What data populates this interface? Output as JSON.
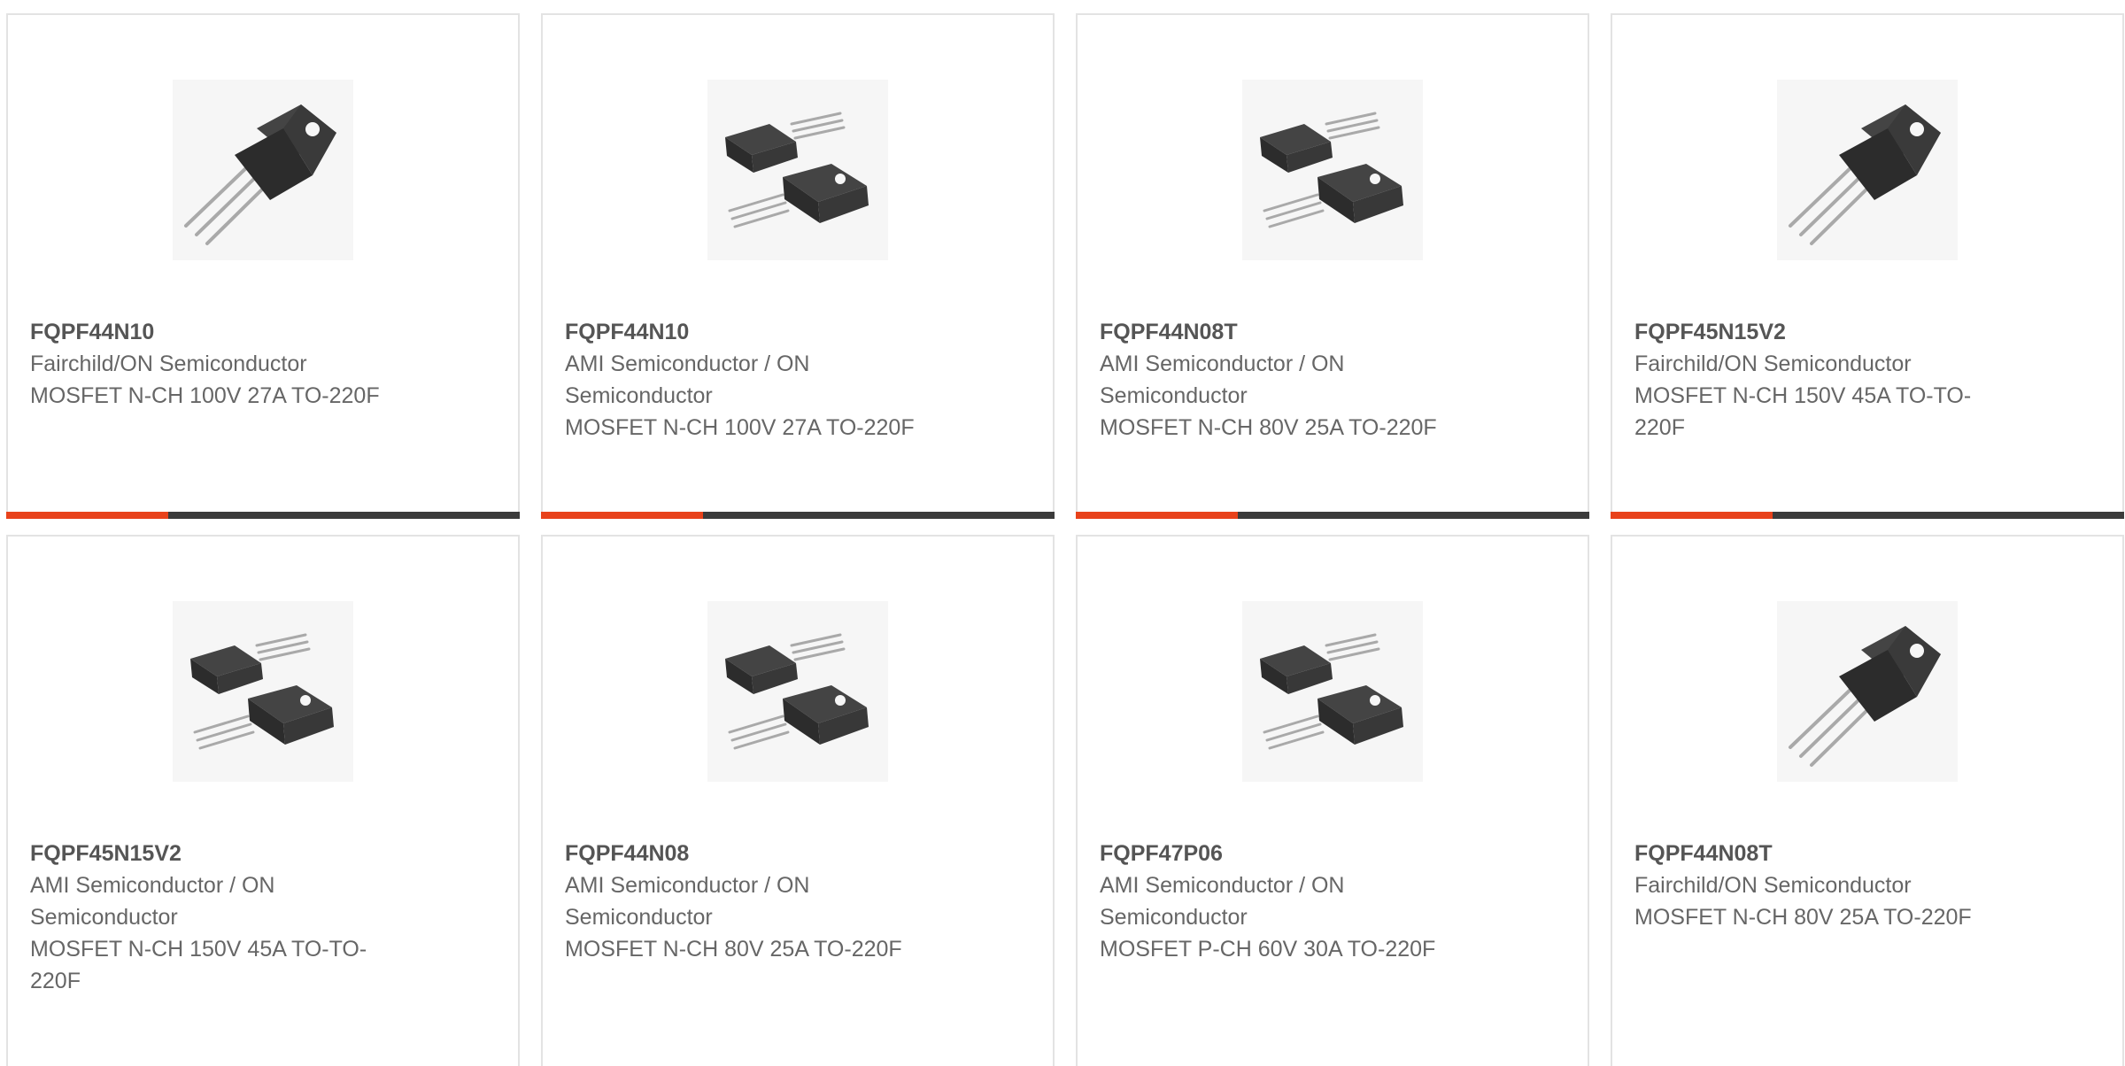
{
  "products": [
    {
      "part": "FQPF44N10",
      "manufacturer": "Fairchild/ON Semiconductor",
      "description": "MOSFET N-CH 100V 27A TO-220F",
      "image_icon": "to220f-single-icon"
    },
    {
      "part": "FQPF44N10",
      "manufacturer": "AMI Semiconductor / ON Semiconductor",
      "description": "MOSFET N-CH 100V 27A TO-220F",
      "image_icon": "to220f-pair-icon"
    },
    {
      "part": "FQPF44N08T",
      "manufacturer": "AMI Semiconductor / ON Semiconductor",
      "description": "MOSFET N-CH 80V 25A TO-220F",
      "image_icon": "to220f-pair-icon"
    },
    {
      "part": "FQPF45N15V2",
      "manufacturer": "Fairchild/ON Semiconductor",
      "description": "MOSFET N-CH 150V 45A TO-TO-220F",
      "image_icon": "to220f-single-icon"
    },
    {
      "part": "FQPF45N15V2",
      "manufacturer": "AMI Semiconductor / ON Semiconductor",
      "description": "MOSFET N-CH 150V 45A TO-TO-220F",
      "image_icon": "to220f-pair-icon"
    },
    {
      "part": "FQPF44N08",
      "manufacturer": "AMI Semiconductor / ON Semiconductor",
      "description": "MOSFET N-CH 80V 25A TO-220F",
      "image_icon": "to220f-pair-icon"
    },
    {
      "part": "FQPF47P06",
      "manufacturer": "AMI Semiconductor / ON Semiconductor",
      "description": "MOSFET P-CH 60V 30A TO-220F",
      "image_icon": "to220f-pair-icon"
    },
    {
      "part": "FQPF44N08T",
      "manufacturer": "Fairchild/ON Semiconductor",
      "description": "MOSFET N-CH 80V 25A TO-220F",
      "image_icon": "to220f-single-icon"
    }
  ],
  "colors": {
    "accent": "#e8421b",
    "bar": "#3b3b3b",
    "text": "#666666",
    "border": "#e3e3e3"
  }
}
